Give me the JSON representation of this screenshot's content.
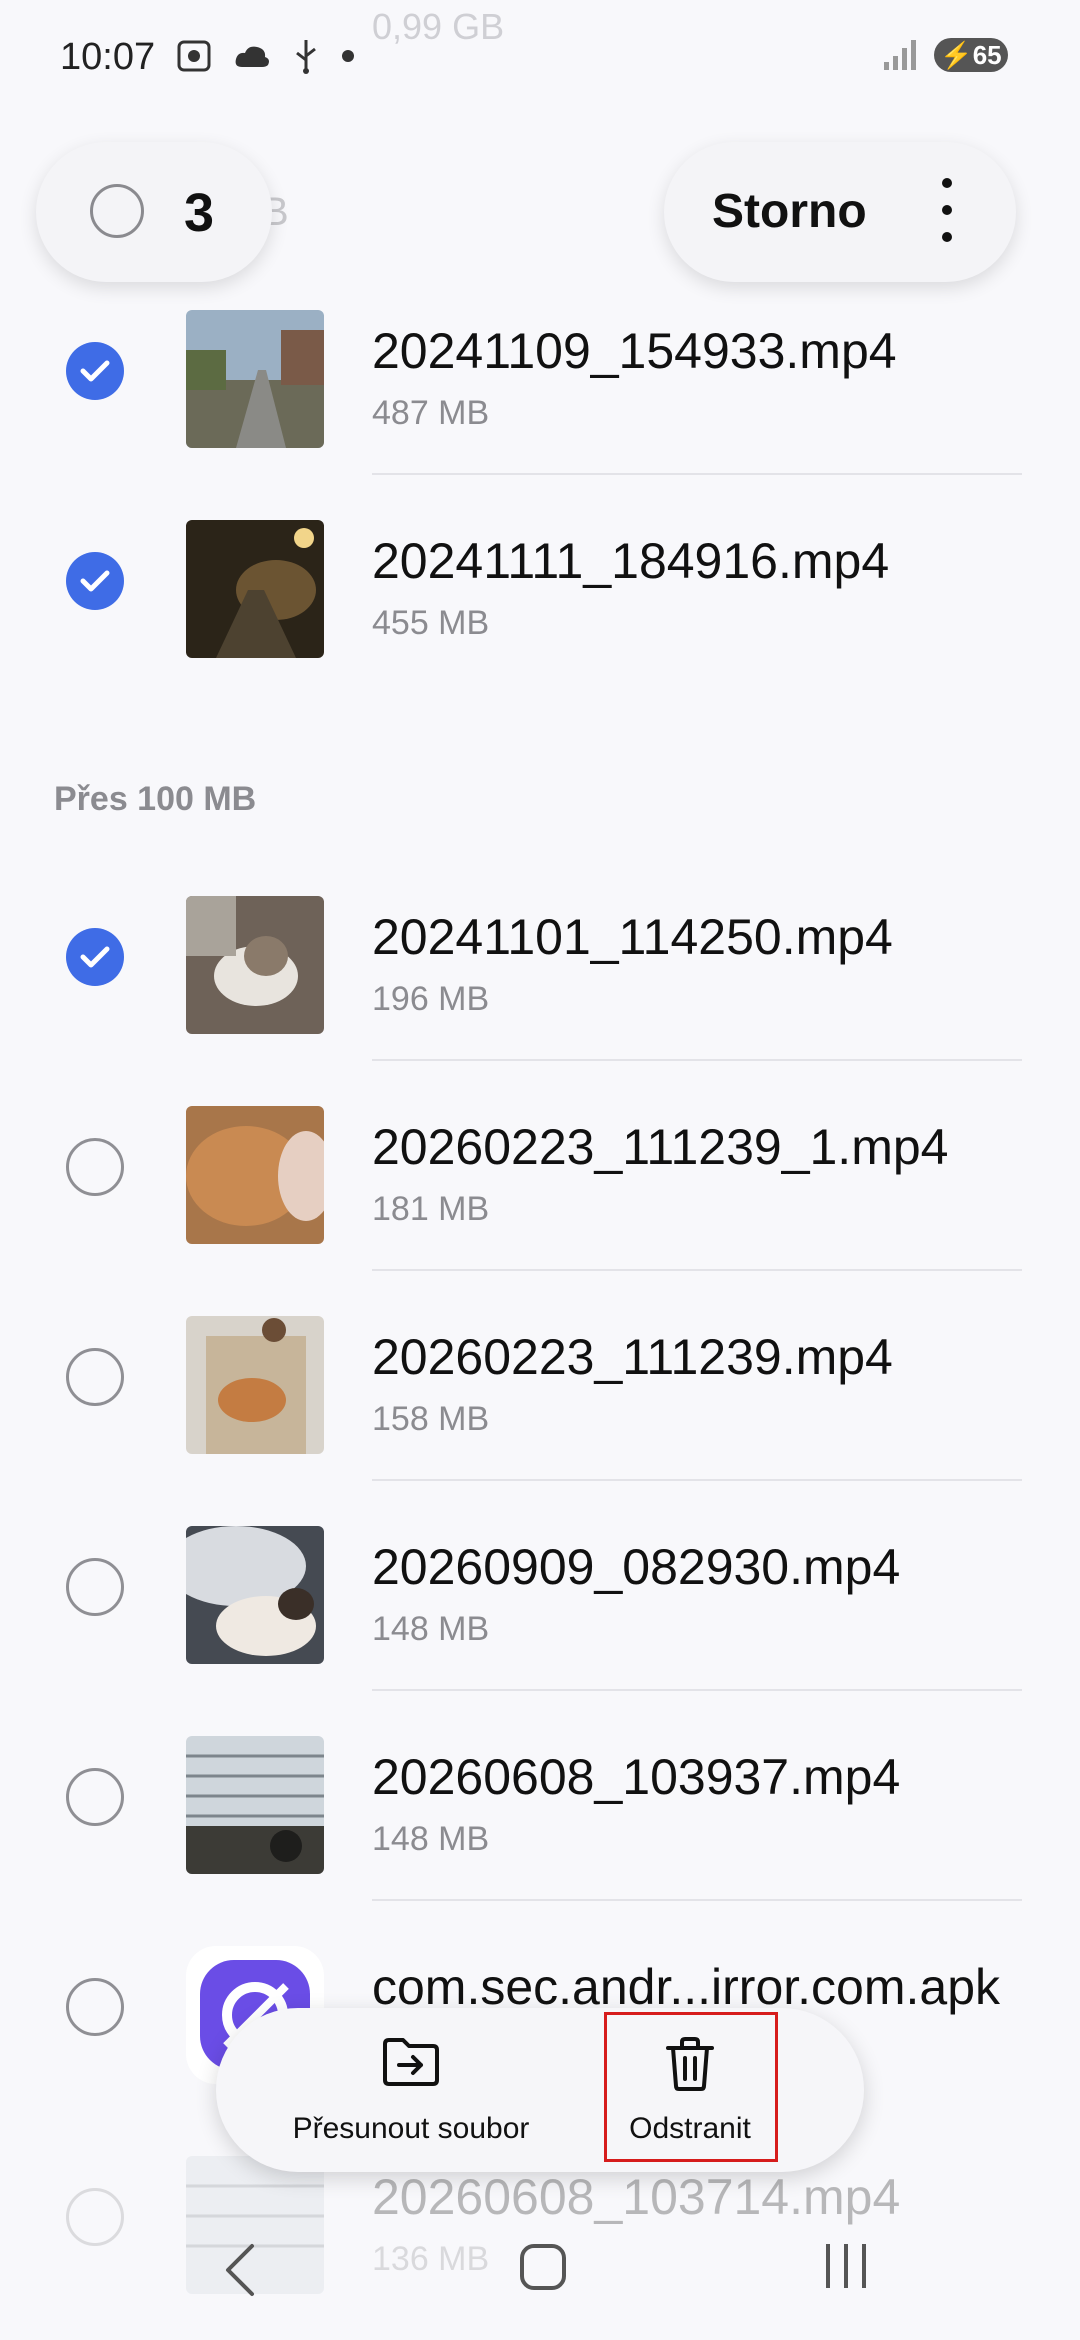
{
  "status": {
    "time": "10:07",
    "battery": "65",
    "ghost_text": "0,99 GB"
  },
  "selection": {
    "count": "3",
    "cancel_label": "Storno",
    "behind_text": "B"
  },
  "section_header": "Přes 100 MB",
  "files_top": [
    {
      "name": "20241109_154933.mp4",
      "size": "487 MB",
      "checked": true
    },
    {
      "name": "20241111_184916.mp4",
      "size": "455 MB",
      "checked": true
    }
  ],
  "files": [
    {
      "name": "20241101_114250.mp4",
      "size": "196 MB",
      "checked": true
    },
    {
      "name": "20260223_111239_1.mp4",
      "size": "181 MB",
      "checked": false
    },
    {
      "name": "20260223_111239.mp4",
      "size": "158 MB",
      "checked": false
    },
    {
      "name": "20260909_082930.mp4",
      "size": "148 MB",
      "checked": false
    },
    {
      "name": "20260608_103937.mp4",
      "size": "148 MB",
      "checked": false
    },
    {
      "name": "com.sec.andr...irror.com.apk",
      "size": "",
      "checked": false
    },
    {
      "name": "20260608_103714.mp4",
      "size": "136 MB",
      "checked": false
    }
  ],
  "actions": {
    "move_label": "Přesunout soubor",
    "delete_label": "Odstranit"
  },
  "colors": {
    "accent": "#3f6ce6",
    "highlight": "#d61c1c"
  }
}
